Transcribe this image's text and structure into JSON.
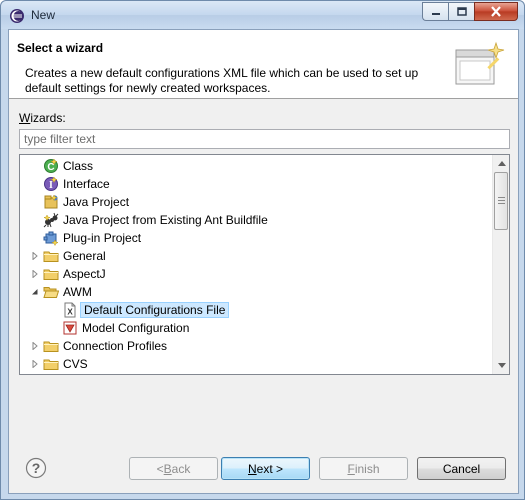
{
  "window": {
    "title": "New"
  },
  "header": {
    "title": "Select a wizard",
    "description": "Creates a new default configurations XML file which can be used to set up default settings for newly created workspaces."
  },
  "wizards": {
    "label_prefix": "W",
    "label_rest": "izards:",
    "filter_placeholder": "type filter text",
    "filter_value": ""
  },
  "tree": {
    "items": [
      {
        "label": "Class",
        "icon": "class-icon",
        "depth": 1,
        "expandable": false
      },
      {
        "label": "Interface",
        "icon": "interface-icon",
        "depth": 1,
        "expandable": false
      },
      {
        "label": "Java Project",
        "icon": "java-project-icon",
        "depth": 1,
        "expandable": false
      },
      {
        "label": "Java Project from Existing Ant Buildfile",
        "icon": "ant-icon",
        "depth": 1,
        "expandable": false
      },
      {
        "label": "Plug-in Project",
        "icon": "plugin-project-icon",
        "depth": 1,
        "expandable": false
      },
      {
        "label": "General",
        "icon": "folder-icon",
        "depth": 1,
        "expandable": true,
        "expanded": false
      },
      {
        "label": "AspectJ",
        "icon": "folder-icon",
        "depth": 1,
        "expandable": true,
        "expanded": false
      },
      {
        "label": "AWM",
        "icon": "folder-open-icon",
        "depth": 1,
        "expandable": true,
        "expanded": true
      },
      {
        "label": "Default Configurations File",
        "icon": "xml-file-icon",
        "depth": 2,
        "expandable": false,
        "selected": true
      },
      {
        "label": "Model Configuration",
        "icon": "model-config-icon",
        "depth": 2,
        "expandable": false
      },
      {
        "label": "Connection Profiles",
        "icon": "folder-icon",
        "depth": 1,
        "expandable": true,
        "expanded": false
      },
      {
        "label": "CVS",
        "icon": "folder-icon",
        "depth": 1,
        "expandable": true,
        "expanded": false
      }
    ]
  },
  "buttons": {
    "back_prefix": "< ",
    "back_mnemonic": "B",
    "back_rest": "ack",
    "next_prefix": "",
    "next_mnemonic": "N",
    "next_rest": "ext >",
    "finish_mnemonic": "F",
    "finish_rest": "inish",
    "cancel": "Cancel"
  },
  "colors": {
    "selection_bg": "#cde8ff",
    "folder": "#e8c25a",
    "accent": "#3c7fb1"
  }
}
